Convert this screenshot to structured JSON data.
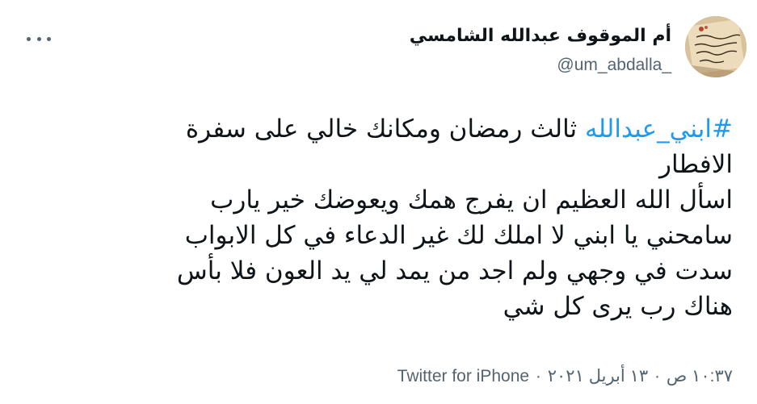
{
  "author": {
    "display_name": "أم الموقوف عبدالله الشامسي",
    "handle": "@um_abdalla_",
    "avatar_icon": "avatar-photo-handwritten-letter"
  },
  "menu": {
    "icon": "more-horizontal-icon"
  },
  "tweet": {
    "hashtag": "#ابني_عبدالله",
    "line1_rest": " ثالث رمضان ومكانك خالي على سفرة",
    "line2": "الافطار",
    "line3": "اسأل الله العظيم ان يفرج همك ويعوضك خير يارب",
    "line4": "سامحني يا ابني لا املك لك غير الدعاء في كل الابواب",
    "line5": "سدت في وجهي ولم اجد من يمد لي يد العون فلا بأس",
    "line6": "هناك رب يرى كل شي"
  },
  "meta": {
    "time": "١٠:٣٧ ص",
    "date": "١٣ أبريل ٢٠٢١",
    "separator": "·",
    "source": "Twitter for iPhone"
  },
  "colors": {
    "link": "#1d9bf0",
    "secondary_text": "#536471",
    "primary_text": "#0f1419"
  }
}
